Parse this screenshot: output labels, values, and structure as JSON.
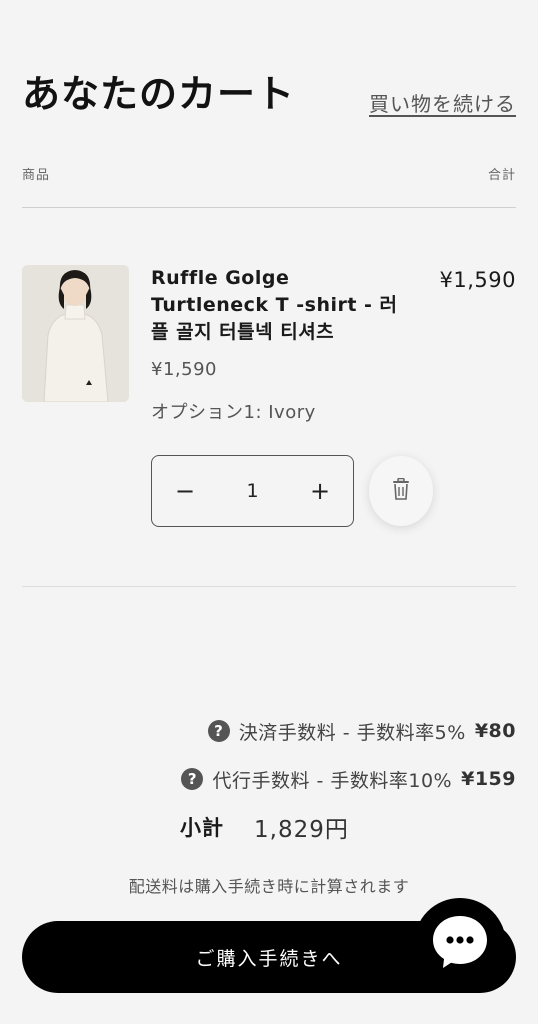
{
  "header": {
    "title": "あなたのカート",
    "continue_label": "買い物を続ける"
  },
  "columns": {
    "product": "商品",
    "total": "合計"
  },
  "items": [
    {
      "name": "Ruffle Golge Turtleneck T -shirt - 러플 골지 터틀넥 티셔츠",
      "line_total": "¥1,590",
      "price": "¥1,590",
      "option": "オプション1: Ivory",
      "quantity": "1",
      "minus_label": "−",
      "plus_label": "+"
    }
  ],
  "fees": [
    {
      "label": "決済手数料 - 手数料率5%",
      "amount": "¥80",
      "help_icon": "question-icon",
      "help_glyph": "?"
    },
    {
      "label": "代行手数料 - 手数料率10%",
      "amount": "¥159",
      "help_icon": "question-icon",
      "help_glyph": "?"
    }
  ],
  "subtotal": {
    "label": "小計",
    "value": "1,829円"
  },
  "shipping_note": "配送料は購入手続き時に計算されます",
  "checkout_label": "ご購入手続きへ",
  "icons": {
    "delete": "trash-icon",
    "chat": "chat-bubble-icon"
  },
  "colors": {
    "background": "#f4f4f4",
    "checkout_bg": "#000000",
    "checkout_text": "#ffffff"
  }
}
